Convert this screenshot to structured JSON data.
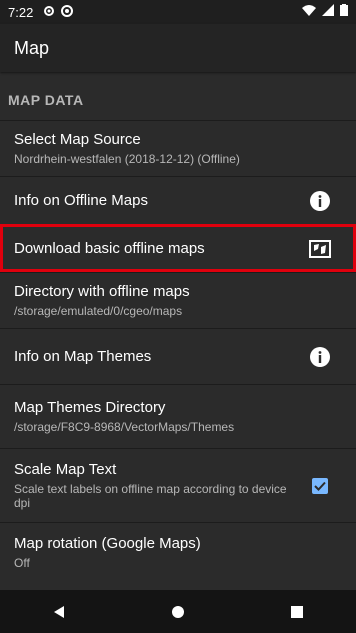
{
  "status": {
    "time": "7:22",
    "icons_left": [
      "gear-icon",
      "circle-sync-icon"
    ],
    "icons_right": [
      "wifi-icon",
      "signal-icon",
      "battery-icon"
    ]
  },
  "app": {
    "title": "Map"
  },
  "section": {
    "title": "MAP DATA"
  },
  "rows": [
    {
      "title": "Select Map Source",
      "summary": "Nordrhein-westfalen (2018-12-12) (Offline)"
    },
    {
      "title": "Info on Offline Maps",
      "icon": "info-icon"
    },
    {
      "title": "Download basic offline maps",
      "icon": "map-icon"
    },
    {
      "title": "Directory with offline maps",
      "summary": "/storage/emulated/0/cgeo/maps"
    },
    {
      "title": "Info on Map Themes",
      "icon": "info-icon"
    },
    {
      "title": "Map Themes Directory",
      "summary": "/storage/F8C9-8968/VectorMaps/Themes"
    },
    {
      "title": "Scale Map Text",
      "summary": "Scale text labels on offline map according to device dpi",
      "checked": true
    },
    {
      "title": "Map rotation (Google Maps)",
      "summary": "Off"
    }
  ],
  "nav": [
    "back-icon",
    "home-icon",
    "recents-icon"
  ],
  "colors": {
    "background": "#2b2b2b",
    "highlight": "#e0000d",
    "checkbox": "#79b8ff"
  }
}
